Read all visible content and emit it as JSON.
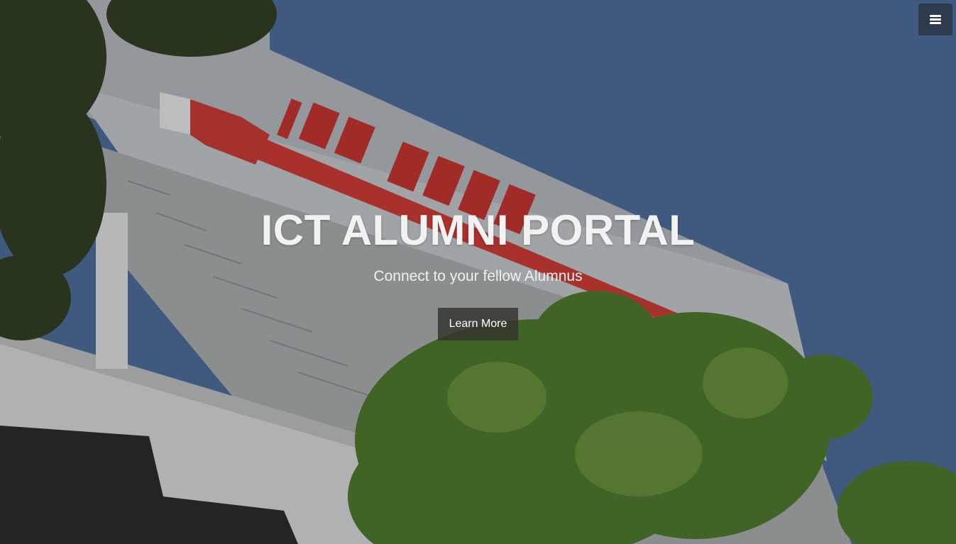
{
  "hero": {
    "background_description": "photo of ICT building facade with red sign, blue sky and trees",
    "building_sign": "ICT BLDG",
    "title": "ICT ALUMNI PORTAL",
    "subtitle": "Connect to your fellow Alumnus",
    "cta_label": "Learn More"
  },
  "menu": {
    "icon": "hamburger-menu-icon"
  },
  "colors": {
    "sky": "#4f6f9f",
    "building": "#c8ccd0",
    "sign_red": "#d63a36",
    "foliage": "#4f7a2e",
    "menu_bg": "#2e3b4e",
    "button_bg": "#33332d"
  }
}
